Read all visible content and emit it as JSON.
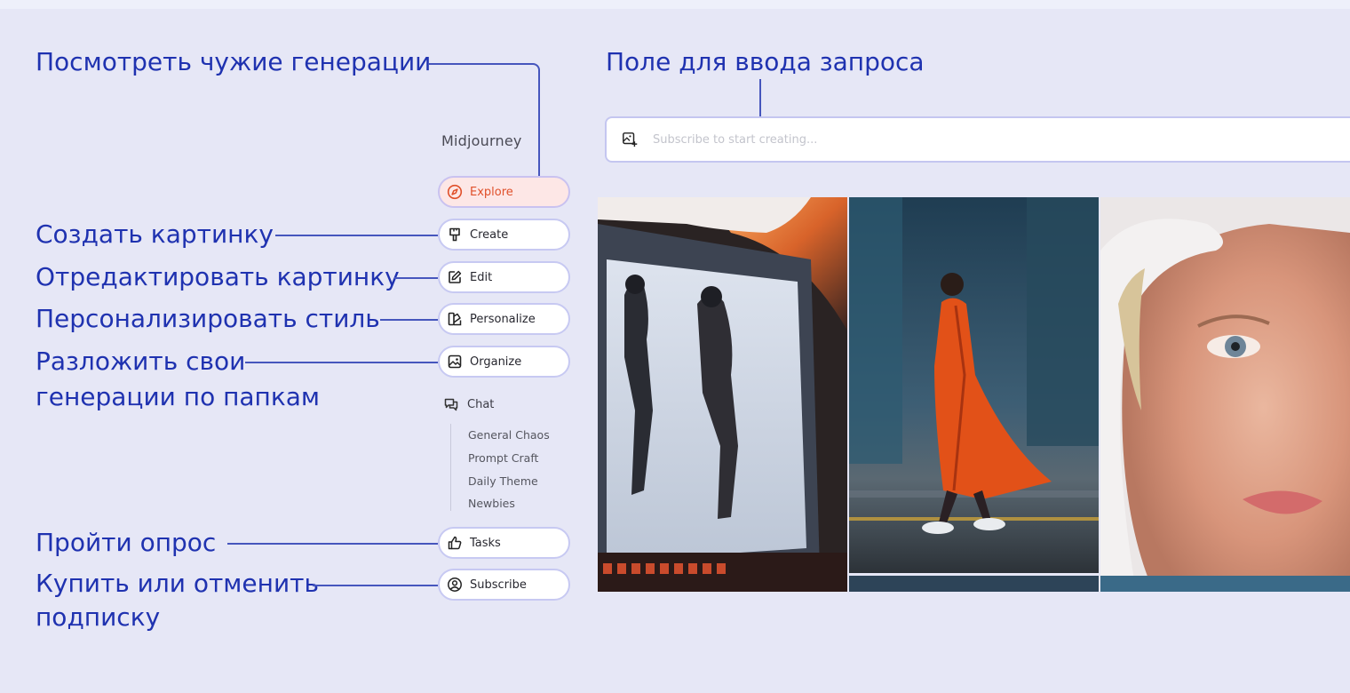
{
  "annotations": {
    "explore": "Посмотреть чужие генерации",
    "prompt": "Поле для ввода запроса",
    "create": "Создать картинку",
    "edit": "Отредактировать картинку",
    "personalize": "Персонализировать стиль",
    "organize_line1": "Разложить свои",
    "organize_line2": "генерации по папкам",
    "tasks": "Пройти опрос",
    "subscribe_line1": "Купить или отменить",
    "subscribe_line2": "подписку"
  },
  "sidebar": {
    "brand": "Midjourney",
    "items": [
      {
        "label": "Explore",
        "icon": "compass-icon",
        "active": true
      },
      {
        "label": "Create",
        "icon": "paintbrush-icon"
      },
      {
        "label": "Edit",
        "icon": "pencil-square-icon"
      },
      {
        "label": "Personalize",
        "icon": "palette-icon"
      },
      {
        "label": "Organize",
        "icon": "image-icon"
      }
    ],
    "chat": {
      "label": "Chat",
      "icon": "chat-bubbles-icon",
      "channels": [
        "General Chaos",
        "Prompt Craft",
        "Daily Theme",
        "Newbies"
      ]
    },
    "bottom": [
      {
        "label": "Tasks",
        "icon": "thumbs-up-icon"
      },
      {
        "label": "Subscribe",
        "icon": "user-circle-icon"
      }
    ]
  },
  "search": {
    "placeholder": "Subscribe to start creating...",
    "icon": "image-plus-icon"
  },
  "colors": {
    "background": "#e6e7f6",
    "annotation_text": "#1f32b0",
    "active_item_text": "#e0502a",
    "active_item_bg": "#fde7e6"
  }
}
